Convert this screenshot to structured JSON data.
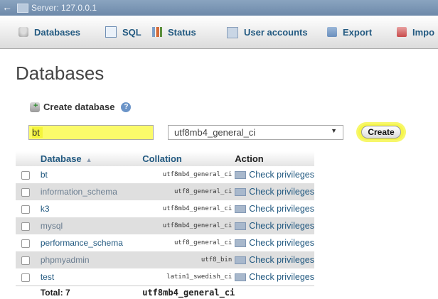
{
  "topbar": {
    "server_label": "Server: 127.0.0.1"
  },
  "tabs": [
    {
      "label": "Databases",
      "icon": "database-icon"
    },
    {
      "label": "SQL",
      "icon": "sql-icon"
    },
    {
      "label": "Status",
      "icon": "status-icon"
    },
    {
      "label": "User accounts",
      "icon": "user-accounts-icon"
    },
    {
      "label": "Export",
      "icon": "export-icon"
    },
    {
      "label": "Impo",
      "icon": "import-icon"
    }
  ],
  "page": {
    "title": "Databases"
  },
  "create": {
    "heading": "Create database",
    "db_name_value": "bt",
    "collation_value": "utf8mb4_general_ci",
    "button_label": "Create",
    "highlight_color": "#f6f64a"
  },
  "table": {
    "headers": {
      "database": "Database",
      "collation": "Collation",
      "action": "Action"
    },
    "rows": [
      {
        "name": "bt",
        "collation": "utf8mb4_general_ci",
        "action": "Check privileges"
      },
      {
        "name": "information_schema",
        "collation": "utf8_general_ci",
        "action": "Check privileges"
      },
      {
        "name": "k3",
        "collation": "utf8mb4_general_ci",
        "action": "Check privileges"
      },
      {
        "name": "mysql",
        "collation": "utf8mb4_general_ci",
        "action": "Check privileges"
      },
      {
        "name": "performance_schema",
        "collation": "utf8_general_ci",
        "action": "Check privileges"
      },
      {
        "name": "phpmyadmin",
        "collation": "utf8_bin",
        "action": "Check privileges"
      },
      {
        "name": "test",
        "collation": "latin1_swedish_ci",
        "action": "Check privileges"
      }
    ],
    "total": {
      "label": "Total: 7",
      "collation": "utf8mb4_general_ci"
    }
  }
}
